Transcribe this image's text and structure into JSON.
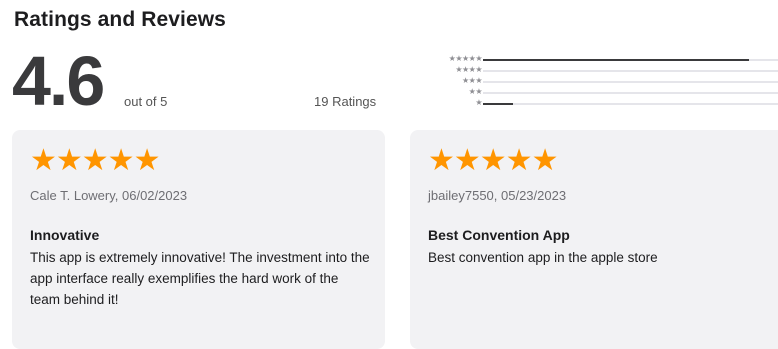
{
  "section": {
    "title": "Ratings and Reviews"
  },
  "summary": {
    "score": "4.6",
    "out_of": "out of 5",
    "ratings_count": "19 Ratings"
  },
  "histogram": [
    {
      "stars": "★★★★★",
      "fraction": 0.9
    },
    {
      "stars": "★★★★",
      "fraction": 0.0
    },
    {
      "stars": "★★★",
      "fraction": 0.0
    },
    {
      "stars": "★★",
      "fraction": 0.0
    },
    {
      "stars": "★",
      "fraction": 0.1
    }
  ],
  "reviews": [
    {
      "stars": "★★★★★",
      "reviewer": "Cale T. Lowery, 06/02/2023",
      "title": "Innovative",
      "body": "This app is extremely innovative! The investment into the app interface really exemplifies the hard work of the team behind it!"
    },
    {
      "stars": "★★★★★",
      "reviewer": "jbailey7550, 05/23/2023",
      "title": "Best Convention App",
      "body": "Best convention app in the apple store"
    }
  ],
  "colors": {
    "star": "#ff9500",
    "bar_fill": "#3a3a3c",
    "bar_track": "#e5e5ea",
    "card_bg": "#f2f2f4"
  }
}
